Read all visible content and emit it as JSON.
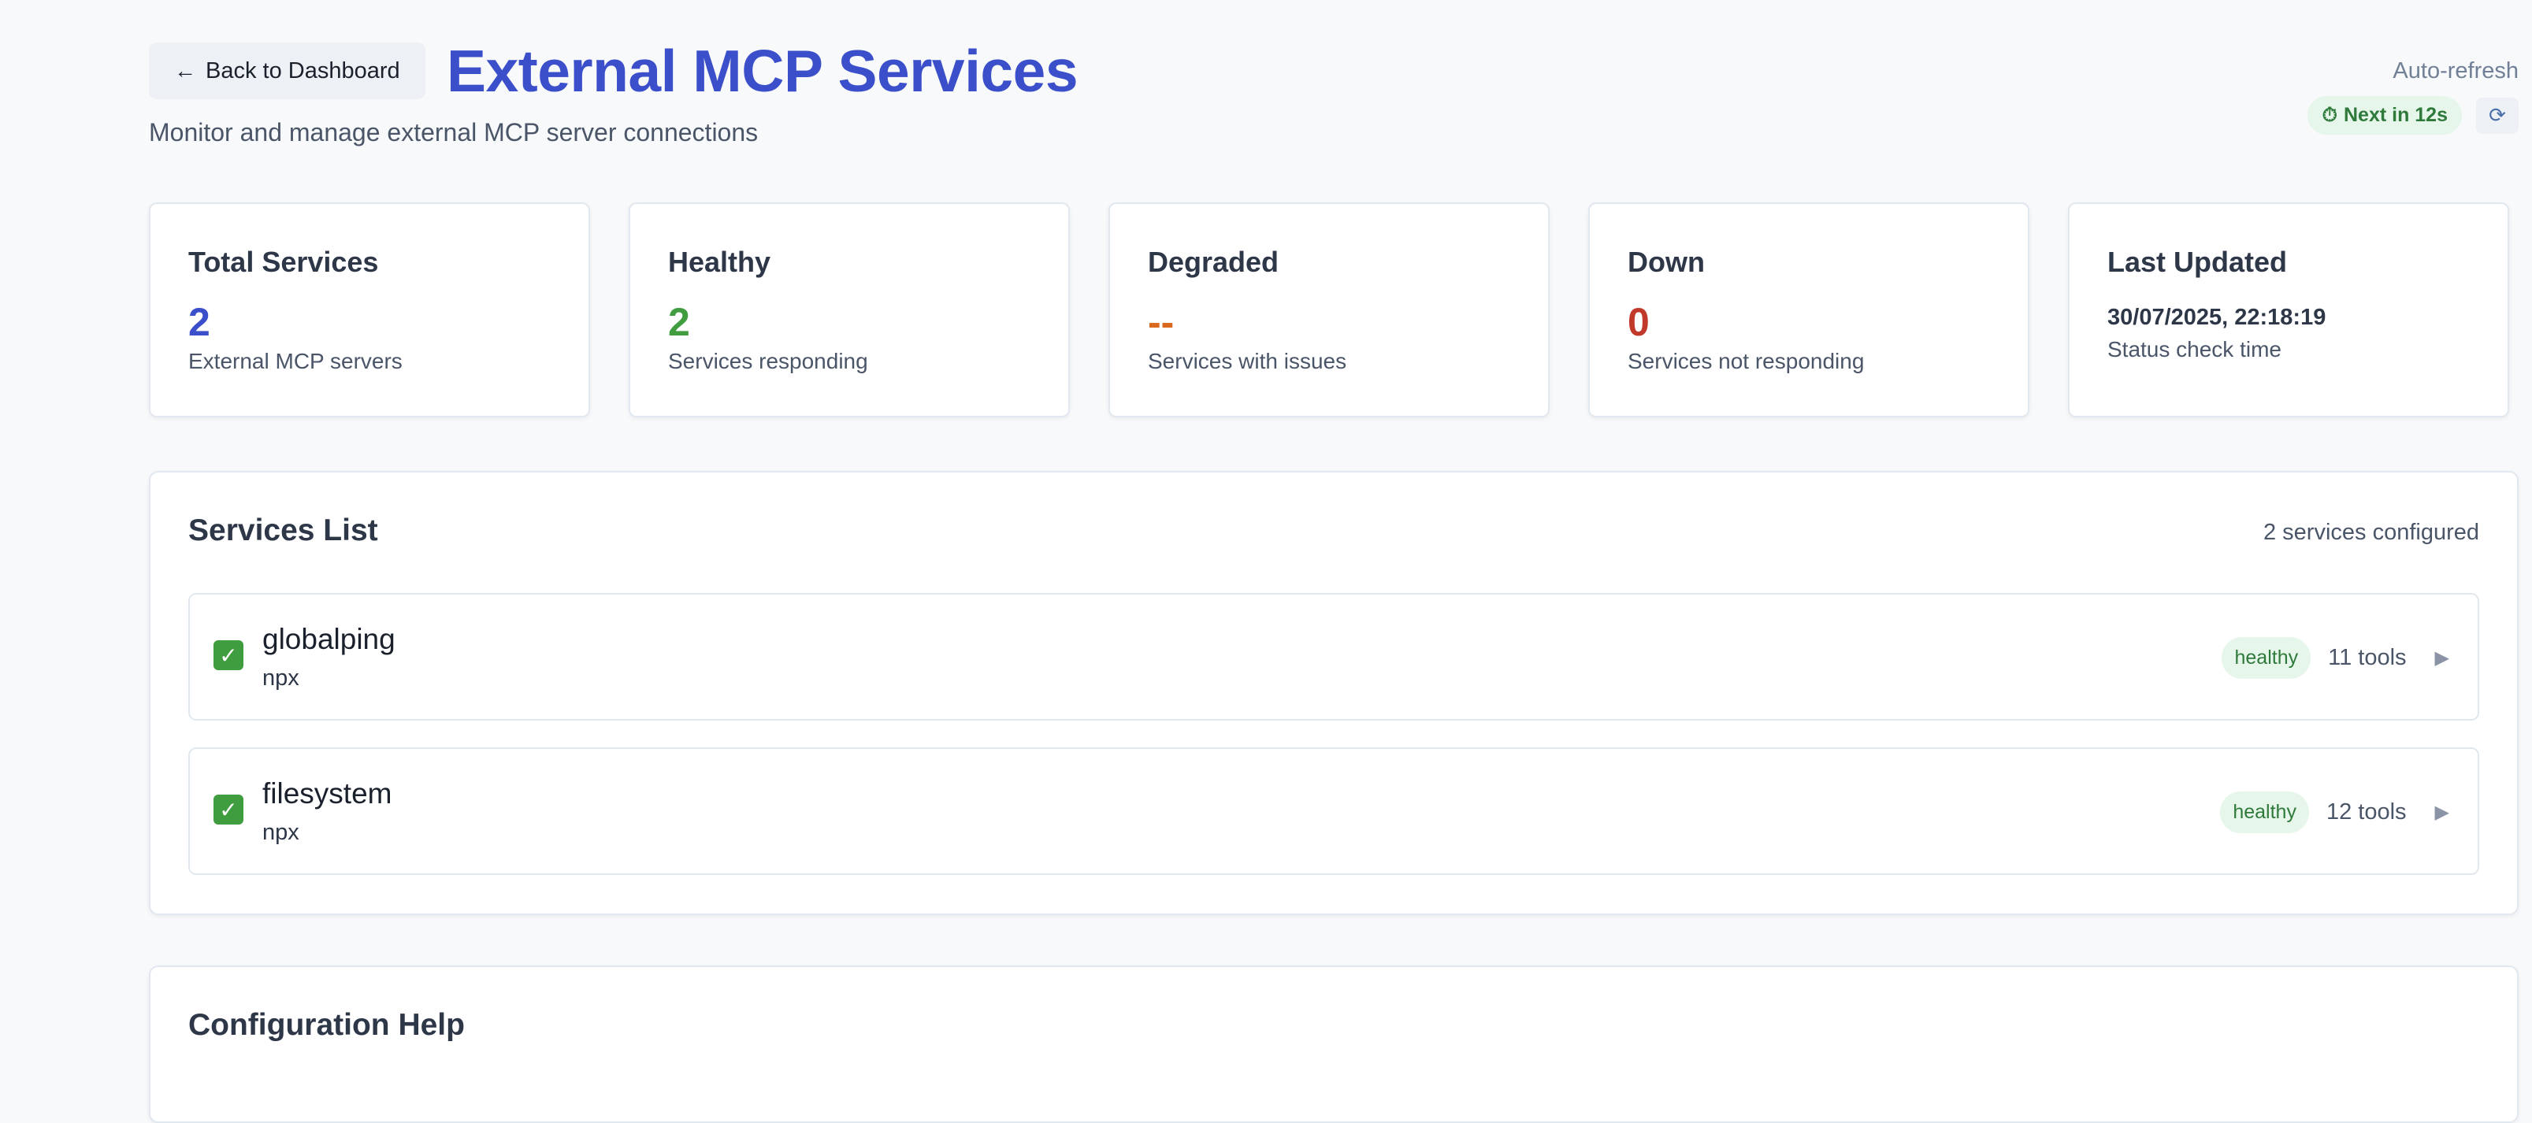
{
  "header": {
    "back_label": "Back to Dashboard",
    "back_icon": "arrow-left-icon",
    "title": "External MCP Services",
    "subtitle": "Monitor and manage external MCP server connections",
    "auto_refresh_label": "Auto-refresh",
    "next_refresh": "Next in 12s",
    "timer_icon": "stopwatch-icon",
    "refresh_icon": "refresh-icon"
  },
  "stats": [
    {
      "title": "Total Services",
      "value": "2",
      "desc": "External MCP servers",
      "color": "#3b4fcb"
    },
    {
      "title": "Healthy",
      "value": "2",
      "desc": "Services responding",
      "color": "#3f9d3f"
    },
    {
      "title": "Degraded",
      "value": "--",
      "desc": "Services with issues",
      "color": "#d9691f"
    },
    {
      "title": "Down",
      "value": "0",
      "desc": "Services not responding",
      "color": "#c0392b"
    }
  ],
  "last_updated": {
    "title": "Last Updated",
    "datetime": "30/07/2025, 22:18:19",
    "desc": "Status check time"
  },
  "services_list": {
    "title": "Services List",
    "count_label": "2 services configured",
    "services": [
      {
        "name": "globalping",
        "command": "npx",
        "status": "healthy",
        "tools": "11 tools",
        "status_icon": "check-mark-icon",
        "expand_icon": "play-triangle-icon"
      },
      {
        "name": "filesystem",
        "command": "npx",
        "status": "healthy",
        "tools": "12 tools",
        "status_icon": "check-mark-icon",
        "expand_icon": "play-triangle-icon"
      }
    ]
  },
  "config_help": {
    "title": "Configuration Help"
  },
  "colors": {
    "accent": "#3b4fcb",
    "healthy": "#3f9d3f",
    "degraded": "#d9691f",
    "down": "#c0392b"
  }
}
